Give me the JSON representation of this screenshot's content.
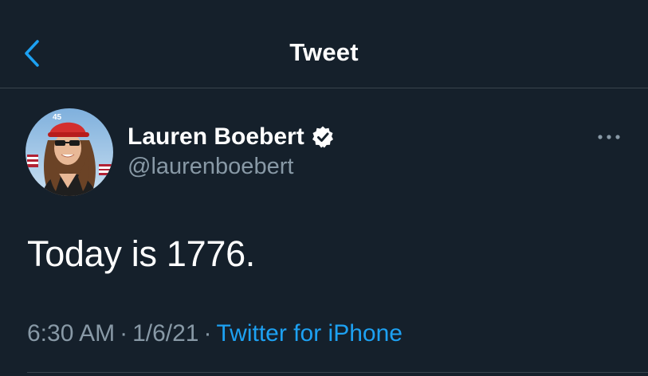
{
  "header": {
    "title": "Tweet"
  },
  "tweet": {
    "author_name": "Lauren Boebert",
    "handle": "@laurenboebert",
    "text": "Today is 1776.",
    "time": "6:30 AM",
    "date": "1/6/21",
    "source": "Twitter for iPhone",
    "separator": "·",
    "avatar_cap_text": "45"
  },
  "icons": {
    "back": "chevron-left-icon",
    "verified": "verified-badge-icon",
    "more": "more-options-icon"
  },
  "colors": {
    "background": "#15202b",
    "accent": "#1da1f2",
    "secondary_text": "#8899a6",
    "divider": "#38444d",
    "cap_red": "#d32f2f"
  }
}
